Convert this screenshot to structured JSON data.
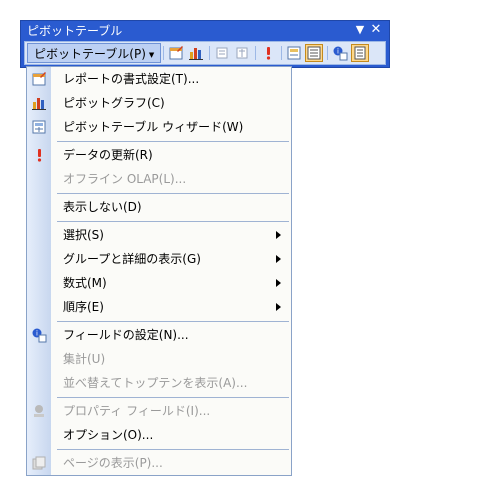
{
  "toolbar": {
    "title": "ピボットテーブル",
    "dropdown_glyph": "▼",
    "close_glyph": "✕",
    "menu_label": "ピボットテーブル(P)",
    "buttons": [
      {
        "name": "format-report-icon"
      },
      {
        "name": "pivot-chart-icon"
      },
      {
        "name": "hide-detail-icon"
      },
      {
        "name": "show-detail-icon"
      },
      {
        "name": "refresh-data-icon"
      },
      {
        "name": "include-hidden-items-icon"
      },
      {
        "name": "always-display-items-icon"
      },
      {
        "name": "field-settings-icon"
      },
      {
        "name": "field-list-icon"
      }
    ]
  },
  "menu": {
    "items": [
      {
        "label": "レポートの書式設定(T)...",
        "icon": "format-report-icon",
        "enabled": true
      },
      {
        "label": "ピボットグラフ(C)",
        "icon": "pivot-chart-icon",
        "enabled": true
      },
      {
        "label": "ピボットテーブル ウィザード(W)",
        "icon": "wizard-icon",
        "enabled": true
      },
      {
        "label": "データの更新(R)",
        "icon": "refresh-data-icon",
        "enabled": true
      },
      {
        "label": "オフライン OLAP(L)...",
        "icon": null,
        "enabled": false
      },
      {
        "label": "表示しない(D)",
        "icon": null,
        "enabled": true
      },
      {
        "label": "選択(S)",
        "icon": null,
        "enabled": true,
        "submenu": true
      },
      {
        "label": "グループと詳細の表示(G)",
        "icon": null,
        "enabled": true,
        "submenu": true
      },
      {
        "label": "数式(M)",
        "icon": null,
        "enabled": true,
        "submenu": true
      },
      {
        "label": "順序(E)",
        "icon": null,
        "enabled": true,
        "submenu": true
      },
      {
        "label": "フィールドの設定(N)...",
        "icon": "field-settings-icon",
        "enabled": true
      },
      {
        "label": "集計(U)",
        "icon": null,
        "enabled": false
      },
      {
        "label": "並べ替えてトップテンを表示(A)...",
        "icon": null,
        "enabled": false
      },
      {
        "label": "プロパティ フィールド(I)...",
        "icon": "property-fields-icon",
        "enabled": false
      },
      {
        "label": "オプション(O)...",
        "icon": null,
        "enabled": true
      },
      {
        "label": "ページの表示(P)...",
        "icon": "show-pages-icon",
        "enabled": false
      }
    ]
  }
}
